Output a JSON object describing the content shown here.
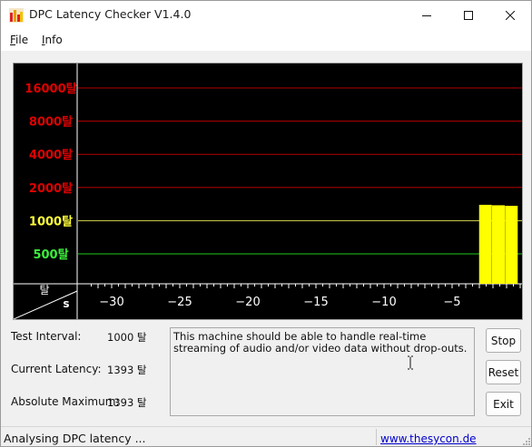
{
  "window": {
    "title": "DPC Latency Checker V1.4.0",
    "controls": [
      "minimize",
      "maximize",
      "close"
    ]
  },
  "menu": {
    "file": {
      "first": "F",
      "rest": "ile"
    },
    "info": {
      "first": "I",
      "rest": "nfo"
    }
  },
  "chart_data": {
    "type": "bar",
    "ylabels": [
      "16000탈",
      "8000탈",
      "4000탈",
      "2000탈",
      "1000탈",
      "500탈"
    ],
    "ylabel_colors": [
      "#e00000",
      "#e00000",
      "#e00000",
      "#e00000",
      "#ffff3c",
      "#3cf03c"
    ],
    "gridline_colors": [
      "#b40000",
      "#b40000",
      "#b40000",
      "#b40000",
      "#d8d850",
      "#1ec81e"
    ],
    "y_scale": "log2",
    "y_ticks": [
      500,
      1000,
      2000,
      4000,
      8000,
      16000
    ],
    "x_ticks": [
      -30,
      -25,
      -20,
      -15,
      -10,
      -5
    ],
    "x_range": [
      -31.5,
      1
    ],
    "corner_unit_y": "탈",
    "corner_unit_x": "s",
    "bar_color": "#ffff00",
    "bars": [
      {
        "x": -2.55,
        "y": 1393
      },
      {
        "x": -1.6,
        "y": 1380
      },
      {
        "x": -0.65,
        "y": 1365
      }
    ]
  },
  "stats": {
    "test_interval_label": "Test Interval:",
    "test_interval_value": "1000 탈",
    "current_latency_label": "Current Latency:",
    "current_latency_value": "1393 탈",
    "absolute_maximum_label": "Absolute Maximum:",
    "absolute_maximum_value": "1393 탈"
  },
  "message": "This machine should be able to handle real-time streaming of audio and/or video data without drop-outs.",
  "buttons": {
    "stop": "Stop",
    "reset": "Reset",
    "exit": "Exit"
  },
  "status": {
    "text": "Analysing DPC latency ...",
    "link": "www.thesycon.de"
  }
}
